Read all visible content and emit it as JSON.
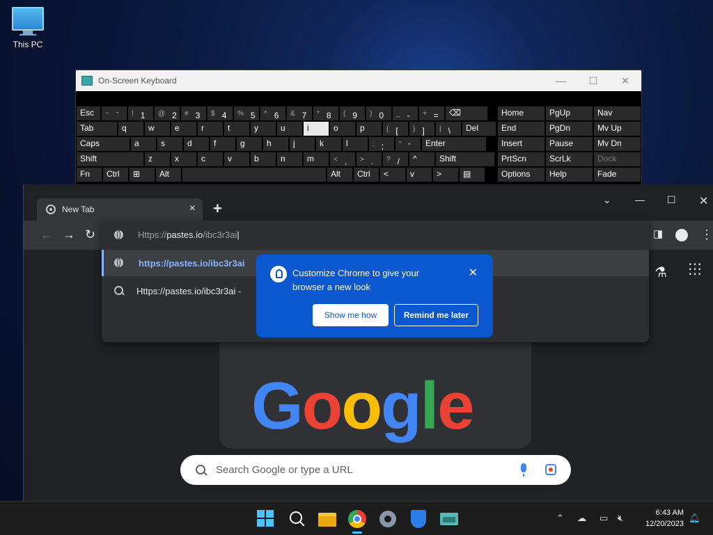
{
  "desktop": {
    "icon_label": "This PC"
  },
  "osk": {
    "title": "On-Screen Keyboard",
    "rows": [
      [
        {
          "m": "Esc"
        },
        {
          "s": "~",
          "m": "`"
        },
        {
          "s": "!",
          "m": "1"
        },
        {
          "s": "@",
          "m": "2"
        },
        {
          "s": "#",
          "m": "3"
        },
        {
          "s": "$",
          "m": "4"
        },
        {
          "s": "%",
          "m": "5"
        },
        {
          "s": "^",
          "m": "6"
        },
        {
          "s": "&",
          "m": "7"
        },
        {
          "s": "*",
          "m": "8"
        },
        {
          "s": "(",
          "m": "9"
        },
        {
          "s": ")",
          "m": "0"
        },
        {
          "s": "_",
          "m": "-"
        },
        {
          "s": "+",
          "m": "="
        },
        {
          "m": "⌫"
        }
      ],
      [
        {
          "m": "Tab"
        },
        {
          "m": "q"
        },
        {
          "m": "w"
        },
        {
          "m": "e"
        },
        {
          "m": "r"
        },
        {
          "m": "t"
        },
        {
          "m": "y"
        },
        {
          "m": "u"
        },
        {
          "m": "i"
        },
        {
          "m": "o"
        },
        {
          "m": "p"
        },
        {
          "s": "{",
          "m": "["
        },
        {
          "s": "}",
          "m": "]"
        },
        {
          "s": "|",
          "m": "\\"
        },
        {
          "m": "Del"
        }
      ],
      [
        {
          "m": "Caps"
        },
        {
          "m": "a"
        },
        {
          "m": "s"
        },
        {
          "m": "d"
        },
        {
          "m": "f"
        },
        {
          "m": "g"
        },
        {
          "m": "h"
        },
        {
          "m": "j"
        },
        {
          "m": "k"
        },
        {
          "m": "l"
        },
        {
          "s": ":",
          "m": ";"
        },
        {
          "s": "\"",
          "m": "'"
        },
        {
          "m": "Enter"
        }
      ],
      [
        {
          "m": "Shift"
        },
        {
          "m": "z"
        },
        {
          "m": "x"
        },
        {
          "m": "c"
        },
        {
          "m": "v"
        },
        {
          "m": "b"
        },
        {
          "m": "n"
        },
        {
          "m": "m"
        },
        {
          "s": "<",
          "m": ","
        },
        {
          "s": ">",
          "m": "."
        },
        {
          "s": "?",
          "m": "/"
        },
        {
          "m": "^"
        },
        {
          "m": "Shift"
        }
      ],
      [
        {
          "m": "Fn"
        },
        {
          "m": "Ctrl"
        },
        {
          "m": "⊞"
        },
        {
          "m": "Alt"
        },
        {
          "m": ""
        },
        {
          "m": "Alt"
        },
        {
          "m": "Ctrl"
        },
        {
          "m": "<"
        },
        {
          "m": "v"
        },
        {
          "m": ">"
        },
        {
          "m": "▤"
        }
      ]
    ],
    "side": [
      [
        "Home",
        "PgUp",
        "Nav"
      ],
      [
        "End",
        "PgDn",
        "Mv Up"
      ],
      [
        "Insert",
        "Pause",
        "Mv Dn"
      ],
      [
        "PrtScn",
        "ScrLk",
        "Dock"
      ],
      [
        "Options",
        "Help",
        "Fade"
      ]
    ]
  },
  "chrome": {
    "tab_title": "New Tab",
    "omnibox_prefix": "Https://",
    "omnibox_host": "pastes.io",
    "omnibox_path": "/ibc3r3ai",
    "suggestions": [
      {
        "text": "https://pastes.io/ibc3r3ai"
      },
      {
        "text": "Https://pastes.io/ibc3r3ai -"
      }
    ],
    "search_placeholder": "Search Google or type a URL",
    "doodle_text": "Google"
  },
  "bubble": {
    "message": "Customize Chrome to give your browser a new look",
    "primary": "Show me how",
    "secondary": "Remind me later"
  },
  "taskbar": {
    "time": "6:43 AM",
    "date": "12/20/2023"
  },
  "colors": {
    "accent": "#0b57d0",
    "link": "#8ab4f8"
  }
}
